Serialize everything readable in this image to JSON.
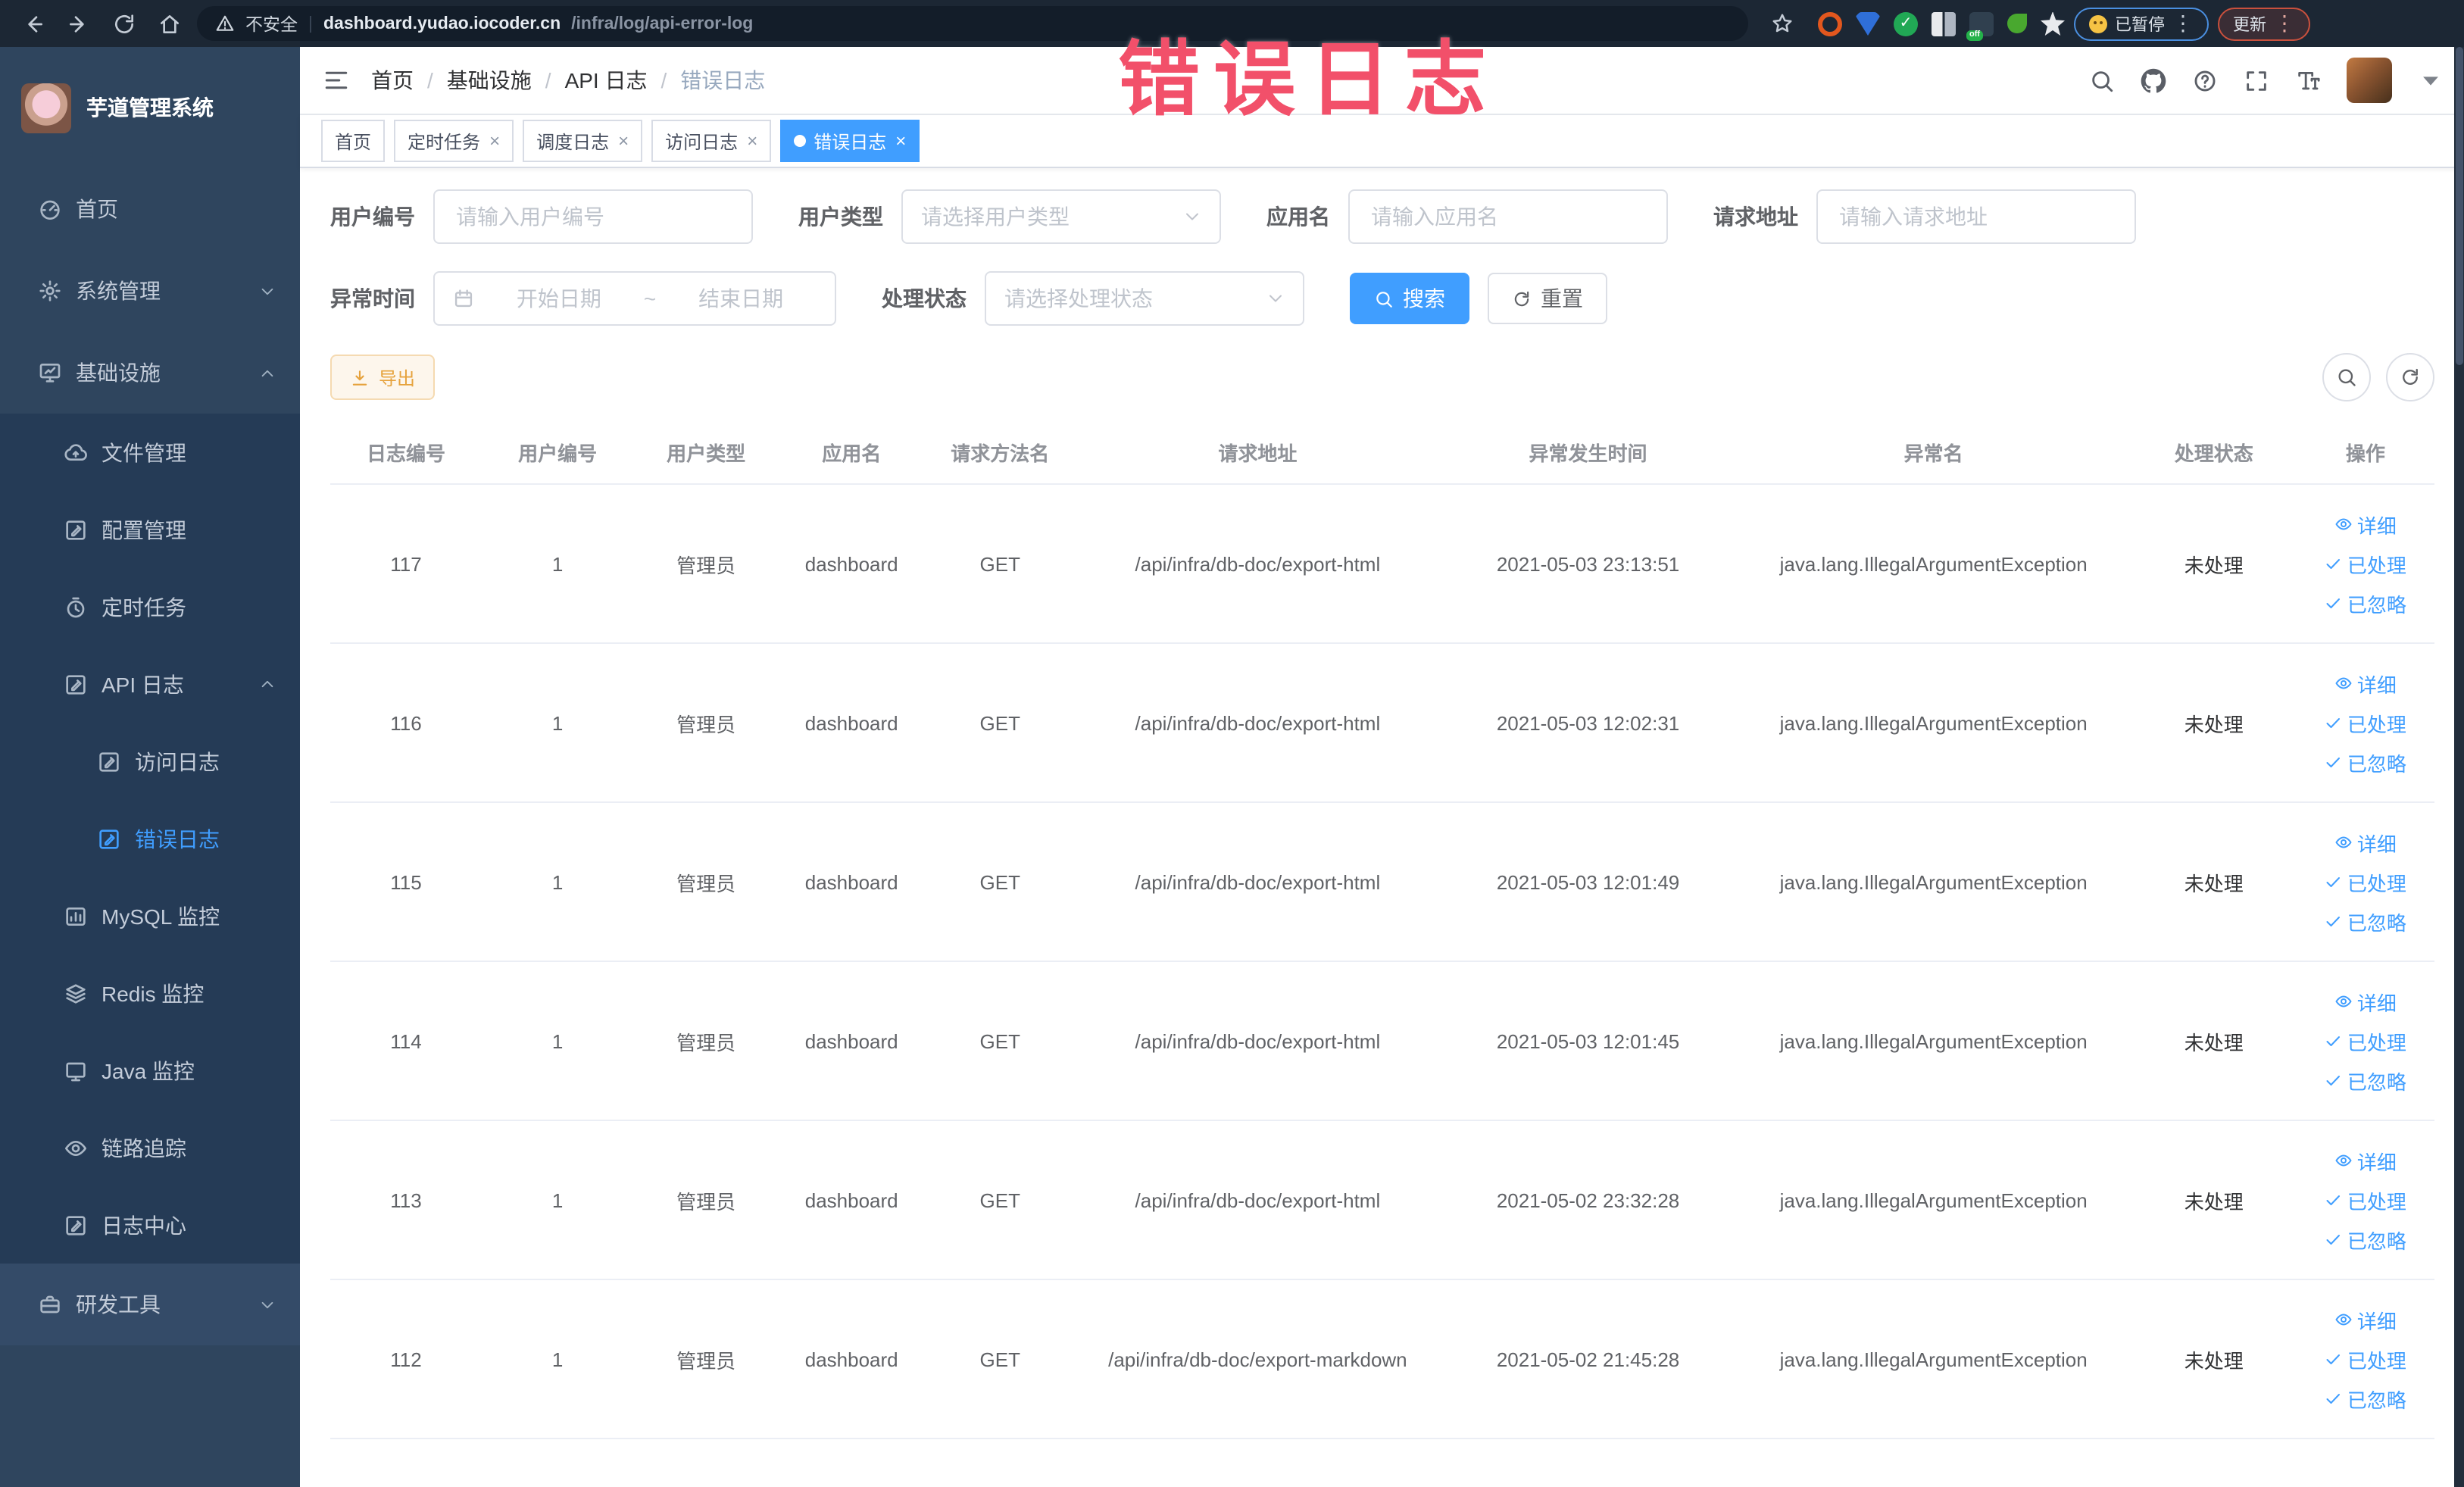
{
  "browser": {
    "security_label": "不安全",
    "url_domain": "dashboard.yudao.iocoder.cn",
    "url_path": "/infra/log/api-error-log",
    "paused_button": "已暂停",
    "update_button": "更新"
  },
  "watermark": "错误日志",
  "sidebar": {
    "logo_title": "芋道管理系统",
    "items": [
      {
        "label": "首页",
        "icon": "dashboard-icon"
      },
      {
        "label": "系统管理",
        "icon": "gear-icon",
        "arrow": "down"
      },
      {
        "label": "基础设施",
        "icon": "infra-monitor-icon",
        "arrow": "up"
      },
      {
        "label": "文件管理",
        "icon": "cloud-upload-icon"
      },
      {
        "label": "配置管理",
        "icon": "edit-icon"
      },
      {
        "label": "定时任务",
        "icon": "timer-icon"
      },
      {
        "label": "API 日志",
        "icon": "log-edit-icon",
        "arrow": "up"
      },
      {
        "label": "访问日志",
        "icon": "log-edit-icon"
      },
      {
        "label": "错误日志",
        "icon": "log-edit-icon",
        "active": true
      },
      {
        "label": "MySQL 监控",
        "icon": "chart-icon"
      },
      {
        "label": "Redis 监控",
        "icon": "layers-icon"
      },
      {
        "label": "Java 监控",
        "icon": "screen-icon"
      },
      {
        "label": "链路追踪",
        "icon": "eye-icon"
      },
      {
        "label": "日志中心",
        "icon": "log-edit-icon"
      },
      {
        "label": "研发工具",
        "icon": "toolbox-icon",
        "arrow": "down"
      }
    ]
  },
  "header": {
    "breadcrumb": [
      "首页",
      "基础设施",
      "API 日志",
      "错误日志"
    ],
    "separator": "/"
  },
  "tabs": [
    {
      "label": "首页"
    },
    {
      "label": "定时任务"
    },
    {
      "label": "调度日志"
    },
    {
      "label": "访问日志"
    },
    {
      "label": "错误日志"
    }
  ],
  "filters": {
    "user_id_label": "用户编号",
    "user_id_placeholder": "请输入用户编号",
    "user_type_label": "用户类型",
    "user_type_placeholder": "请选择用户类型",
    "app_name_label": "应用名",
    "app_name_placeholder": "请输入应用名",
    "request_url_label": "请求地址",
    "request_url_placeholder": "请输入请求地址",
    "exception_time_label": "异常时间",
    "date_start_placeholder": "开始日期",
    "date_separator": "~",
    "date_end_placeholder": "结束日期",
    "process_status_label": "处理状态",
    "process_status_placeholder": "请选择处理状态",
    "search_button": "搜索",
    "reset_button": "重置"
  },
  "toolbar": {
    "export_button": "导出"
  },
  "table": {
    "columns": [
      "日志编号",
      "用户编号",
      "用户类型",
      "应用名",
      "请求方法名",
      "请求地址",
      "异常发生时间",
      "异常名",
      "处理状态",
      "操作"
    ],
    "actions": {
      "detail": "详细",
      "processed": "已处理",
      "ignored": "已忽略"
    },
    "rows": [
      {
        "id": "117",
        "user_id": "1",
        "user_type": "管理员",
        "app": "dashboard",
        "method": "GET",
        "url": "/api/infra/db-doc/export-html",
        "time": "2021-05-03 23:13:51",
        "exception": "java.lang.IllegalArgumentException",
        "status": "未处理"
      },
      {
        "id": "116",
        "user_id": "1",
        "user_type": "管理员",
        "app": "dashboard",
        "method": "GET",
        "url": "/api/infra/db-doc/export-html",
        "time": "2021-05-03 12:02:31",
        "exception": "java.lang.IllegalArgumentException",
        "status": "未处理"
      },
      {
        "id": "115",
        "user_id": "1",
        "user_type": "管理员",
        "app": "dashboard",
        "method": "GET",
        "url": "/api/infra/db-doc/export-html",
        "time": "2021-05-03 12:01:49",
        "exception": "java.lang.IllegalArgumentException",
        "status": "未处理"
      },
      {
        "id": "114",
        "user_id": "1",
        "user_type": "管理员",
        "app": "dashboard",
        "method": "GET",
        "url": "/api/infra/db-doc/export-html",
        "time": "2021-05-03 12:01:45",
        "exception": "java.lang.IllegalArgumentException",
        "status": "未处理"
      },
      {
        "id": "113",
        "user_id": "1",
        "user_type": "管理员",
        "app": "dashboard",
        "method": "GET",
        "url": "/api/infra/db-doc/export-html",
        "time": "2021-05-02 23:32:28",
        "exception": "java.lang.IllegalArgumentException",
        "status": "未处理"
      },
      {
        "id": "112",
        "user_id": "1",
        "user_type": "管理员",
        "app": "dashboard",
        "method": "GET",
        "url": "/api/infra/db-doc/export-markdown",
        "time": "2021-05-02 21:45:28",
        "exception": "java.lang.IllegalArgumentException",
        "status": "未处理"
      }
    ]
  },
  "icons": {
    "close_glyph": "×"
  }
}
